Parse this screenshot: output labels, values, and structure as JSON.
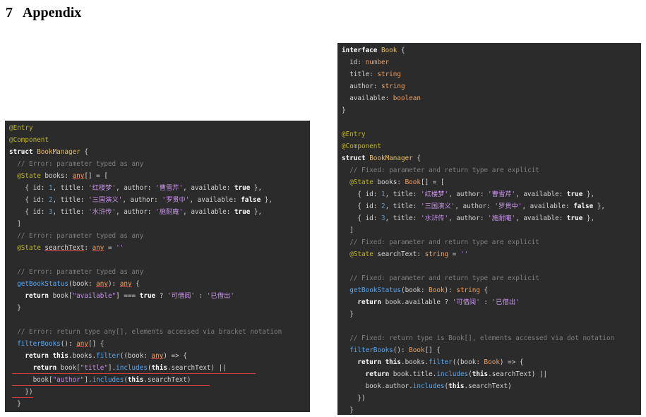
{
  "heading": "7   Appendix",
  "left_code": [
    [
      [
        "ann",
        "@Entry"
      ]
    ],
    [
      [
        "ann",
        "@Component"
      ]
    ],
    [
      [
        "kw",
        "struct "
      ],
      [
        "type",
        "BookManager"
      ],
      [
        "plain",
        " {"
      ]
    ],
    [
      [
        "plain",
        "  "
      ],
      [
        "com",
        "// Error: parameter typed as any"
      ]
    ],
    [
      [
        "plain",
        "  "
      ],
      [
        "ann",
        "@State "
      ],
      [
        "plain",
        "books: "
      ],
      [
        "tpul",
        "any"
      ],
      [
        "plain",
        "[] = ["
      ]
    ],
    [
      [
        "plain",
        "    { id: "
      ],
      [
        "num",
        "1"
      ],
      [
        "plain",
        ", title: "
      ],
      [
        "str",
        "'红楼梦'"
      ],
      [
        "plain",
        ", author: "
      ],
      [
        "str",
        "'曹雪芹'"
      ],
      [
        "plain",
        ", available: "
      ],
      [
        "bool",
        "true"
      ],
      [
        "plain",
        " },"
      ]
    ],
    [
      [
        "plain",
        "    { id: "
      ],
      [
        "num",
        "2"
      ],
      [
        "plain",
        ", title: "
      ],
      [
        "str",
        "'三国演义'"
      ],
      [
        "plain",
        ", author: "
      ],
      [
        "str",
        "'罗贯中'"
      ],
      [
        "plain",
        ", available: "
      ],
      [
        "bool",
        "false"
      ],
      [
        "plain",
        " },"
      ]
    ],
    [
      [
        "plain",
        "    { id: "
      ],
      [
        "num",
        "3"
      ],
      [
        "plain",
        ", title: "
      ],
      [
        "str",
        "'水浒传'"
      ],
      [
        "plain",
        ", author: "
      ],
      [
        "str",
        "'施耐庵'"
      ],
      [
        "plain",
        ", available: "
      ],
      [
        "bool",
        "true"
      ],
      [
        "plain",
        " },"
      ]
    ],
    [
      [
        "plain",
        "  ]"
      ]
    ],
    [
      [
        "plain",
        "  "
      ],
      [
        "com",
        "// Error: parameter typed as any"
      ]
    ],
    [
      [
        "plain",
        "  "
      ],
      [
        "ann",
        "@State "
      ],
      [
        "plainul",
        "searchText"
      ],
      [
        "plain",
        ": "
      ],
      [
        "tpul",
        "any"
      ],
      [
        "plain",
        " = "
      ],
      [
        "str",
        "''"
      ]
    ],
    [
      [
        "plain",
        ""
      ]
    ],
    [
      [
        "plain",
        "  "
      ],
      [
        "com",
        "// Error: parameter typed as any"
      ]
    ],
    [
      [
        "plain",
        "  "
      ],
      [
        "fn",
        "getBookStatus"
      ],
      [
        "plain",
        "(book: "
      ],
      [
        "tpul",
        "any"
      ],
      [
        "plain",
        "): "
      ],
      [
        "tpul",
        "any"
      ],
      [
        "plain",
        " {"
      ]
    ],
    [
      [
        "plain",
        "    "
      ],
      [
        "kw",
        "return "
      ],
      [
        "plain",
        "book["
      ],
      [
        "str",
        "\"available\""
      ],
      [
        "plain",
        "] === "
      ],
      [
        "bool",
        "true"
      ],
      [
        "plain",
        " ? "
      ],
      [
        "str",
        "'可借阅'"
      ],
      [
        "plain",
        " : "
      ],
      [
        "str",
        "'已借出'"
      ]
    ],
    [
      [
        "plain",
        "  }"
      ]
    ],
    [
      [
        "plain",
        ""
      ]
    ],
    [
      [
        "plain",
        "  "
      ],
      [
        "com",
        "// Error: return type any[], elements accessed via bracket notation"
      ]
    ],
    [
      [
        "plain",
        "  "
      ],
      [
        "fn",
        "filterBooks"
      ],
      [
        "plain",
        "(): "
      ],
      [
        "tpul",
        "any"
      ],
      [
        "plain",
        "[] {"
      ]
    ],
    [
      [
        "plain",
        "    "
      ],
      [
        "kw",
        "return "
      ],
      [
        "this",
        "this"
      ],
      [
        "plain",
        ".books."
      ],
      [
        "fn",
        "filter"
      ],
      [
        "plain",
        "((book: "
      ],
      [
        "tpul",
        "any"
      ],
      [
        "plain",
        ") => {"
      ]
    ],
    [
      [
        "plain",
        "      "
      ],
      [
        "kw",
        "return "
      ],
      [
        "plain",
        "book["
      ],
      [
        "str",
        "\"title\""
      ],
      [
        "plain",
        "]."
      ],
      [
        "fn",
        "includes"
      ],
      [
        "plain",
        "("
      ],
      [
        "this",
        "this"
      ],
      [
        "plain",
        ".searchText) ||"
      ]
    ],
    [
      [
        "plain",
        "      book["
      ],
      [
        "str",
        "\"author\""
      ],
      [
        "plain",
        "]."
      ],
      [
        "fn",
        "includes"
      ],
      [
        "plain",
        "("
      ],
      [
        "this",
        "this"
      ],
      [
        "plain",
        ".searchText)"
      ]
    ],
    [
      [
        "plain",
        "    })"
      ]
    ],
    [
      [
        "plain",
        "  }"
      ]
    ]
  ],
  "right_code": [
    [
      [
        "kw",
        "interface "
      ],
      [
        "type",
        "Book"
      ],
      [
        "plain",
        " {"
      ]
    ],
    [
      [
        "plain",
        "  id: "
      ],
      [
        "tp",
        "number"
      ]
    ],
    [
      [
        "plain",
        "  title: "
      ],
      [
        "tp",
        "string"
      ]
    ],
    [
      [
        "plain",
        "  author: "
      ],
      [
        "tp",
        "string"
      ]
    ],
    [
      [
        "plain",
        "  available: "
      ],
      [
        "tp",
        "boolean"
      ]
    ],
    [
      [
        "plain",
        "}"
      ]
    ],
    [
      [
        "plain",
        ""
      ]
    ],
    [
      [
        "ann",
        "@Entry"
      ]
    ],
    [
      [
        "ann",
        "@Component"
      ]
    ],
    [
      [
        "kw",
        "struct "
      ],
      [
        "type",
        "BookManager"
      ],
      [
        "plain",
        " {"
      ]
    ],
    [
      [
        "plain",
        "  "
      ],
      [
        "com",
        "// Fixed: parameter and return type are explicit"
      ]
    ],
    [
      [
        "plain",
        "  "
      ],
      [
        "ann",
        "@State "
      ],
      [
        "plain",
        "books: "
      ],
      [
        "tp",
        "Book"
      ],
      [
        "plain",
        "[] = ["
      ]
    ],
    [
      [
        "plain",
        "    { id: "
      ],
      [
        "num",
        "1"
      ],
      [
        "plain",
        ", title: "
      ],
      [
        "str",
        "'红楼梦'"
      ],
      [
        "plain",
        ", author: "
      ],
      [
        "str",
        "'曹雪芹'"
      ],
      [
        "plain",
        ", available: "
      ],
      [
        "bool",
        "true"
      ],
      [
        "plain",
        " },"
      ]
    ],
    [
      [
        "plain",
        "    { id: "
      ],
      [
        "num",
        "2"
      ],
      [
        "plain",
        ", title: "
      ],
      [
        "str",
        "'三国演义'"
      ],
      [
        "plain",
        ", author: "
      ],
      [
        "str",
        "'罗贯中'"
      ],
      [
        "plain",
        ", available: "
      ],
      [
        "bool",
        "false"
      ],
      [
        "plain",
        " },"
      ]
    ],
    [
      [
        "plain",
        "    { id: "
      ],
      [
        "num",
        "3"
      ],
      [
        "plain",
        ", title: "
      ],
      [
        "str",
        "'水浒传'"
      ],
      [
        "plain",
        ", author: "
      ],
      [
        "str",
        "'施耐庵'"
      ],
      [
        "plain",
        ", available: "
      ],
      [
        "bool",
        "true"
      ],
      [
        "plain",
        " },"
      ]
    ],
    [
      [
        "plain",
        "  ]"
      ]
    ],
    [
      [
        "plain",
        "  "
      ],
      [
        "com",
        "// Fixed: parameter and return type are explicit"
      ]
    ],
    [
      [
        "plain",
        "  "
      ],
      [
        "ann",
        "@State "
      ],
      [
        "plain",
        "searchText: "
      ],
      [
        "tp",
        "string"
      ],
      [
        "plain",
        " = "
      ],
      [
        "str",
        "''"
      ]
    ],
    [
      [
        "plain",
        ""
      ]
    ],
    [
      [
        "plain",
        "  "
      ],
      [
        "com",
        "// Fixed: parameter and return type are explicit"
      ]
    ],
    [
      [
        "plain",
        "  "
      ],
      [
        "fn",
        "getBookStatus"
      ],
      [
        "plain",
        "(book: "
      ],
      [
        "tp",
        "Book"
      ],
      [
        "plain",
        "): "
      ],
      [
        "tp",
        "string"
      ],
      [
        "plain",
        " {"
      ]
    ],
    [
      [
        "plain",
        "    "
      ],
      [
        "kw",
        "return "
      ],
      [
        "plain",
        "book.available ? "
      ],
      [
        "str",
        "'可借阅'"
      ],
      [
        "plain",
        " : "
      ],
      [
        "str",
        "'已借出'"
      ]
    ],
    [
      [
        "plain",
        "  }"
      ]
    ],
    [
      [
        "plain",
        ""
      ]
    ],
    [
      [
        "plain",
        "  "
      ],
      [
        "com",
        "// Fixed: return type is Book[], elements accessed via dot notation"
      ]
    ],
    [
      [
        "plain",
        "  "
      ],
      [
        "fn",
        "filterBooks"
      ],
      [
        "plain",
        "(): "
      ],
      [
        "tp",
        "Book"
      ],
      [
        "plain",
        "[] {"
      ]
    ],
    [
      [
        "plain",
        "    "
      ],
      [
        "kw",
        "return "
      ],
      [
        "this",
        "this"
      ],
      [
        "plain",
        ".books."
      ],
      [
        "fn",
        "filter"
      ],
      [
        "plain",
        "((book: "
      ],
      [
        "tp",
        "Book"
      ],
      [
        "plain",
        ") => {"
      ]
    ],
    [
      [
        "plain",
        "      "
      ],
      [
        "kw",
        "return "
      ],
      [
        "plain",
        "book.title."
      ],
      [
        "fn",
        "includes"
      ],
      [
        "plain",
        "("
      ],
      [
        "this",
        "this"
      ],
      [
        "plain",
        ".searchText) ||"
      ]
    ],
    [
      [
        "plain",
        "      book.author."
      ],
      [
        "fn",
        "includes"
      ],
      [
        "plain",
        "("
      ],
      [
        "this",
        "this"
      ],
      [
        "plain",
        ".searchText)"
      ]
    ],
    [
      [
        "plain",
        "    })"
      ]
    ],
    [
      [
        "plain",
        "  }"
      ]
    ]
  ]
}
